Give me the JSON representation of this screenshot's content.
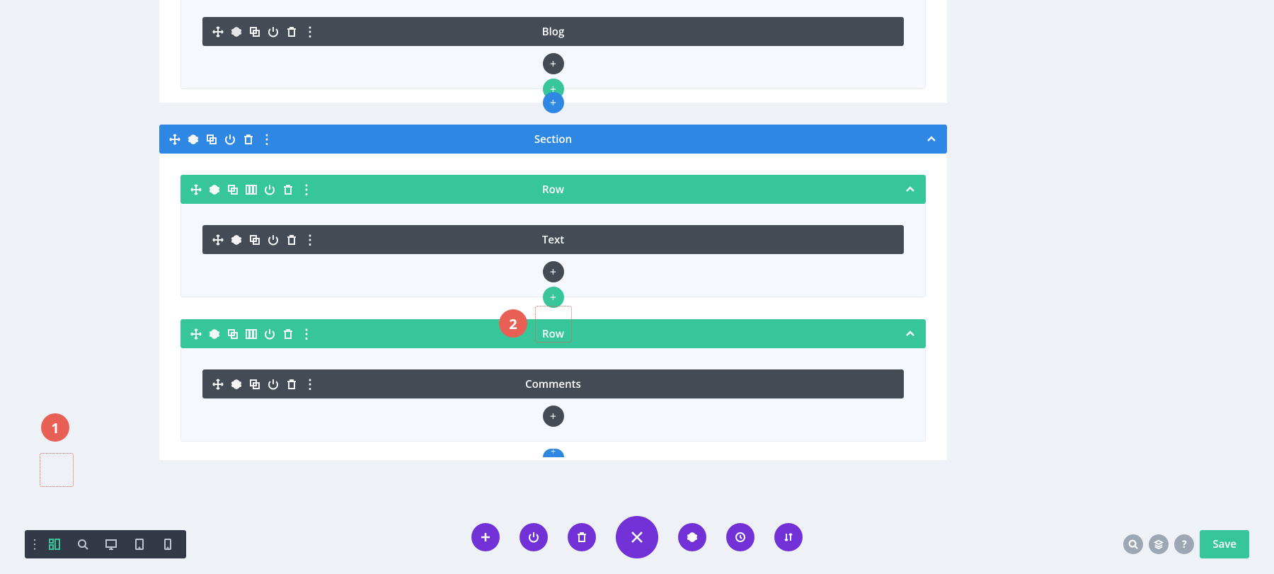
{
  "modules": {
    "blog": "Blog",
    "text": "Text",
    "comments": "Comments"
  },
  "section": "Section",
  "row": "Row",
  "annotations": {
    "one": "1",
    "two": "2"
  },
  "bottom": {
    "save": "Save"
  },
  "icons": {
    "plus": "+",
    "ellipsis": "⋮",
    "help": "?"
  }
}
